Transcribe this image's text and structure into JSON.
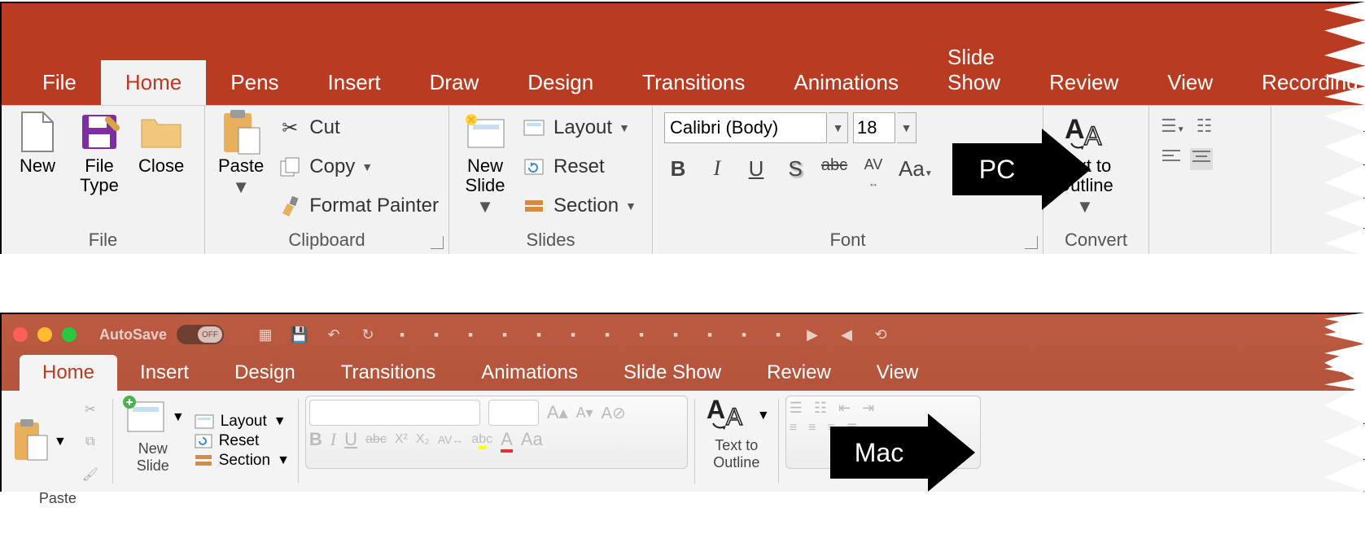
{
  "annotations": {
    "pc_label": "PC",
    "mac_label": "Mac"
  },
  "pc": {
    "tabs": [
      "File",
      "Home",
      "Pens",
      "Insert",
      "Draw",
      "Design",
      "Transitions",
      "Animations",
      "Slide Show",
      "Review",
      "View",
      "Recording"
    ],
    "active_tab_index": 1,
    "groups": {
      "file": {
        "label": "File",
        "new": "New",
        "file_type": "File\nType",
        "close": "Close"
      },
      "clipboard": {
        "label": "Clipboard",
        "paste": "Paste",
        "cut": "Cut",
        "copy": "Copy",
        "format_painter": "Format Painter"
      },
      "slides": {
        "label": "Slides",
        "new_slide": "New\nSlide",
        "layout": "Layout",
        "reset": "Reset",
        "section": "Section"
      },
      "font": {
        "label": "Font",
        "name_value": "Calibri (Body)",
        "size_value": "18",
        "aa": "Aa"
      },
      "convert": {
        "label": "Convert",
        "text_to_outline": "Text to\nOutline"
      }
    }
  },
  "mac": {
    "autosave_label": "AutoSave",
    "autosave_state": "OFF",
    "traffic_colors": [
      "#ff5f57",
      "#febc2e",
      "#28c840"
    ],
    "tabs": [
      "Home",
      "Insert",
      "Design",
      "Transitions",
      "Animations",
      "Slide Show",
      "Review",
      "View"
    ],
    "active_tab_index": 0,
    "paste": "Paste",
    "new_slide": "New\nSlide",
    "layout": "Layout",
    "reset": "Reset",
    "section": "Section",
    "text_to_outline": "Text to\nOutline"
  }
}
